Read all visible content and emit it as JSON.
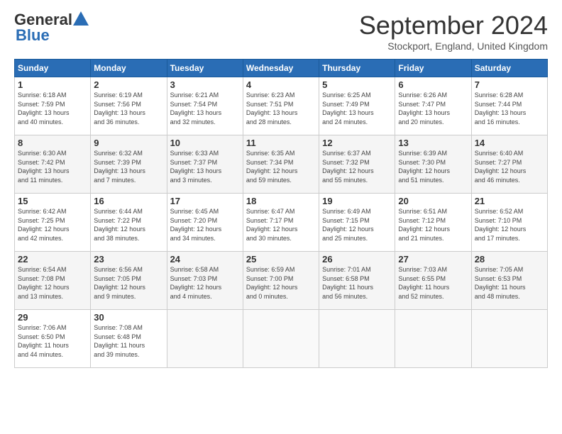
{
  "header": {
    "logo_general": "General",
    "logo_blue": "Blue",
    "month_title": "September 2024",
    "location": "Stockport, England, United Kingdom"
  },
  "weekdays": [
    "Sunday",
    "Monday",
    "Tuesday",
    "Wednesday",
    "Thursday",
    "Friday",
    "Saturday"
  ],
  "weeks": [
    [
      {
        "day": "1",
        "info": "Sunrise: 6:18 AM\nSunset: 7:59 PM\nDaylight: 13 hours\nand 40 minutes."
      },
      {
        "day": "2",
        "info": "Sunrise: 6:19 AM\nSunset: 7:56 PM\nDaylight: 13 hours\nand 36 minutes."
      },
      {
        "day": "3",
        "info": "Sunrise: 6:21 AM\nSunset: 7:54 PM\nDaylight: 13 hours\nand 32 minutes."
      },
      {
        "day": "4",
        "info": "Sunrise: 6:23 AM\nSunset: 7:51 PM\nDaylight: 13 hours\nand 28 minutes."
      },
      {
        "day": "5",
        "info": "Sunrise: 6:25 AM\nSunset: 7:49 PM\nDaylight: 13 hours\nand 24 minutes."
      },
      {
        "day": "6",
        "info": "Sunrise: 6:26 AM\nSunset: 7:47 PM\nDaylight: 13 hours\nand 20 minutes."
      },
      {
        "day": "7",
        "info": "Sunrise: 6:28 AM\nSunset: 7:44 PM\nDaylight: 13 hours\nand 16 minutes."
      }
    ],
    [
      {
        "day": "8",
        "info": "Sunrise: 6:30 AM\nSunset: 7:42 PM\nDaylight: 13 hours\nand 11 minutes."
      },
      {
        "day": "9",
        "info": "Sunrise: 6:32 AM\nSunset: 7:39 PM\nDaylight: 13 hours\nand 7 minutes."
      },
      {
        "day": "10",
        "info": "Sunrise: 6:33 AM\nSunset: 7:37 PM\nDaylight: 13 hours\nand 3 minutes."
      },
      {
        "day": "11",
        "info": "Sunrise: 6:35 AM\nSunset: 7:34 PM\nDaylight: 12 hours\nand 59 minutes."
      },
      {
        "day": "12",
        "info": "Sunrise: 6:37 AM\nSunset: 7:32 PM\nDaylight: 12 hours\nand 55 minutes."
      },
      {
        "day": "13",
        "info": "Sunrise: 6:39 AM\nSunset: 7:30 PM\nDaylight: 12 hours\nand 51 minutes."
      },
      {
        "day": "14",
        "info": "Sunrise: 6:40 AM\nSunset: 7:27 PM\nDaylight: 12 hours\nand 46 minutes."
      }
    ],
    [
      {
        "day": "15",
        "info": "Sunrise: 6:42 AM\nSunset: 7:25 PM\nDaylight: 12 hours\nand 42 minutes."
      },
      {
        "day": "16",
        "info": "Sunrise: 6:44 AM\nSunset: 7:22 PM\nDaylight: 12 hours\nand 38 minutes."
      },
      {
        "day": "17",
        "info": "Sunrise: 6:45 AM\nSunset: 7:20 PM\nDaylight: 12 hours\nand 34 minutes."
      },
      {
        "day": "18",
        "info": "Sunrise: 6:47 AM\nSunset: 7:17 PM\nDaylight: 12 hours\nand 30 minutes."
      },
      {
        "day": "19",
        "info": "Sunrise: 6:49 AM\nSunset: 7:15 PM\nDaylight: 12 hours\nand 25 minutes."
      },
      {
        "day": "20",
        "info": "Sunrise: 6:51 AM\nSunset: 7:12 PM\nDaylight: 12 hours\nand 21 minutes."
      },
      {
        "day": "21",
        "info": "Sunrise: 6:52 AM\nSunset: 7:10 PM\nDaylight: 12 hours\nand 17 minutes."
      }
    ],
    [
      {
        "day": "22",
        "info": "Sunrise: 6:54 AM\nSunset: 7:08 PM\nDaylight: 12 hours\nand 13 minutes."
      },
      {
        "day": "23",
        "info": "Sunrise: 6:56 AM\nSunset: 7:05 PM\nDaylight: 12 hours\nand 9 minutes."
      },
      {
        "day": "24",
        "info": "Sunrise: 6:58 AM\nSunset: 7:03 PM\nDaylight: 12 hours\nand 4 minutes."
      },
      {
        "day": "25",
        "info": "Sunrise: 6:59 AM\nSunset: 7:00 PM\nDaylight: 12 hours\nand 0 minutes."
      },
      {
        "day": "26",
        "info": "Sunrise: 7:01 AM\nSunset: 6:58 PM\nDaylight: 11 hours\nand 56 minutes."
      },
      {
        "day": "27",
        "info": "Sunrise: 7:03 AM\nSunset: 6:55 PM\nDaylight: 11 hours\nand 52 minutes."
      },
      {
        "day": "28",
        "info": "Sunrise: 7:05 AM\nSunset: 6:53 PM\nDaylight: 11 hours\nand 48 minutes."
      }
    ],
    [
      {
        "day": "29",
        "info": "Sunrise: 7:06 AM\nSunset: 6:50 PM\nDaylight: 11 hours\nand 44 minutes."
      },
      {
        "day": "30",
        "info": "Sunrise: 7:08 AM\nSunset: 6:48 PM\nDaylight: 11 hours\nand 39 minutes."
      },
      {
        "day": "",
        "info": ""
      },
      {
        "day": "",
        "info": ""
      },
      {
        "day": "",
        "info": ""
      },
      {
        "day": "",
        "info": ""
      },
      {
        "day": "",
        "info": ""
      }
    ]
  ]
}
